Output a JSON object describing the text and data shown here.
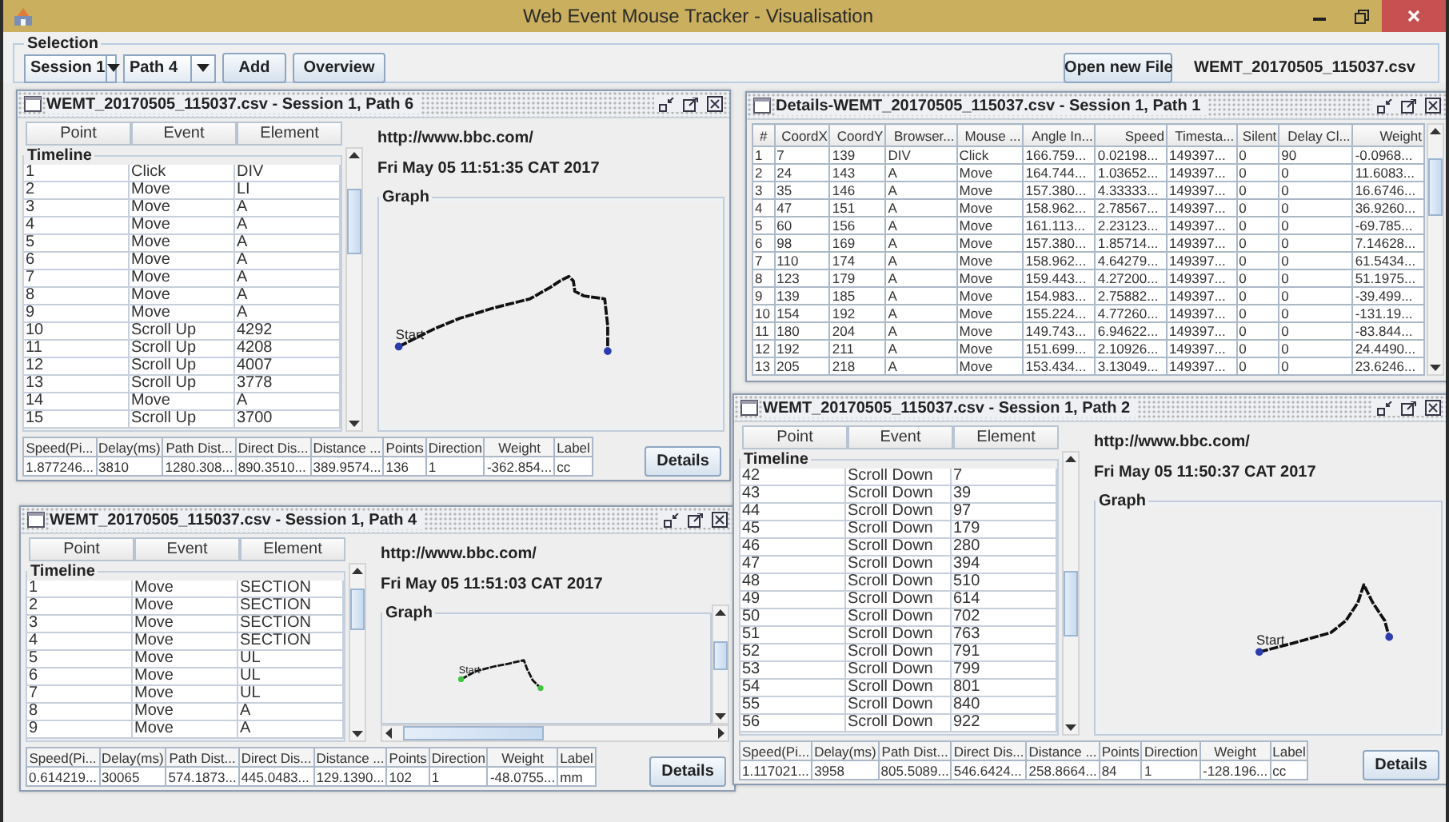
{
  "window": {
    "title": "Web Event Mouse Tracker - Visualisation"
  },
  "selection": {
    "legend": "Selection",
    "session": "Session 1",
    "path": "Path 4",
    "add_button": "Add",
    "overview_button": "Overview",
    "open_button": "Open new File",
    "file_name": "WEMT_20170505_115037.csv"
  },
  "frames": [
    {
      "kind": "path",
      "title": "WEMT_20170505_115037.csv - Session 1, Path 6",
      "columns": [
        "Point",
        "Event",
        "Element"
      ],
      "timeline_label": "Timeline",
      "rows": [
        [
          "1",
          "Click",
          "DIV"
        ],
        [
          "2",
          "Move",
          "LI"
        ],
        [
          "3",
          "Move",
          "A"
        ],
        [
          "4",
          "Move",
          "A"
        ],
        [
          "5",
          "Move",
          "A"
        ],
        [
          "6",
          "Move",
          "A"
        ],
        [
          "7",
          "Move",
          "A"
        ],
        [
          "8",
          "Move",
          "A"
        ],
        [
          "9",
          "Move",
          "A"
        ],
        [
          "10",
          "Scroll Up",
          "4292"
        ],
        [
          "11",
          "Scroll Up",
          "4208"
        ],
        [
          "12",
          "Scroll Up",
          "4007"
        ],
        [
          "13",
          "Scroll Up",
          "3778"
        ],
        [
          "14",
          "Move",
          "A"
        ],
        [
          "15",
          "Scroll Up",
          "3700"
        ]
      ],
      "url": "http://www.bbc.com/",
      "date": "Fri May 05 11:51:35 CAT 2017",
      "graph": {
        "title": "Graph",
        "start_label": "Start",
        "color": "#2a3cb0"
      },
      "stats_columns": [
        "Speed(Pi...",
        "Delay(ms)",
        "Path Dist...",
        "Direct Dis...",
        "Distance ...",
        "Points",
        "Direction",
        "Weight",
        "Label"
      ],
      "stats_values": [
        "1.877246...",
        "3810",
        "1280.308...",
        "890.3510...",
        "389.9574...",
        "136",
        "1",
        "-362.854...",
        "cc"
      ],
      "details_button": "Details"
    },
    {
      "kind": "path",
      "title": "WEMT_20170505_115037.csv - Session 1, Path 4",
      "columns": [
        "Point",
        "Event",
        "Element"
      ],
      "timeline_label": "Timeline",
      "rows": [
        [
          "1",
          "Move",
          "SECTION"
        ],
        [
          "2",
          "Move",
          "SECTION"
        ],
        [
          "3",
          "Move",
          "SECTION"
        ],
        [
          "4",
          "Move",
          "SECTION"
        ],
        [
          "5",
          "Move",
          "UL"
        ],
        [
          "6",
          "Move",
          "UL"
        ],
        [
          "7",
          "Move",
          "UL"
        ],
        [
          "8",
          "Move",
          "A"
        ],
        [
          "9",
          "Move",
          "A"
        ]
      ],
      "url": "http://www.bbc.com/",
      "date": "Fri May 05 11:51:03 CAT 2017",
      "graph": {
        "title": "Graph",
        "start_label": "Start",
        "color": "#3cc83c",
        "scrollbars": true
      },
      "stats_columns": [
        "Speed(Pi...",
        "Delay(ms)",
        "Path Dist...",
        "Direct Dis...",
        "Distance ...",
        "Points",
        "Direction",
        "Weight",
        "Label"
      ],
      "stats_values": [
        "0.614219...",
        "30065",
        "574.1873...",
        "445.0483...",
        "129.1390...",
        "102",
        "1",
        "-48.0755...",
        "mm"
      ],
      "details_button": "Details"
    },
    {
      "kind": "details",
      "title": "Details-WEMT_20170505_115037.csv - Session 1, Path 1",
      "columns": [
        "#",
        "CoordX",
        "CoordY",
        "Browser...",
        "Mouse ...",
        "Angle In...",
        "Speed",
        "Timesta...",
        "Silent",
        "Delay Cl...",
        "Weight"
      ],
      "rows": [
        [
          "1",
          "7",
          "139",
          "DIV",
          "Click",
          "166.759...",
          "0.02198...",
          "149397...",
          "0",
          "90",
          "-0.0968..."
        ],
        [
          "2",
          "24",
          "143",
          "A",
          "Move",
          "164.744...",
          "1.03652...",
          "149397...",
          "0",
          "0",
          "11.6083..."
        ],
        [
          "3",
          "35",
          "146",
          "A",
          "Move",
          "157.380...",
          "4.33333...",
          "149397...",
          "0",
          "0",
          "16.6746..."
        ],
        [
          "4",
          "47",
          "151",
          "A",
          "Move",
          "158.962...",
          "2.78567...",
          "149397...",
          "0",
          "0",
          "36.9260..."
        ],
        [
          "5",
          "60",
          "156",
          "A",
          "Move",
          "161.113...",
          "2.23123...",
          "149397...",
          "0",
          "0",
          "-69.785..."
        ],
        [
          "6",
          "98",
          "169",
          "A",
          "Move",
          "157.380...",
          "1.85714...",
          "149397...",
          "0",
          "0",
          "7.14628..."
        ],
        [
          "7",
          "110",
          "174",
          "A",
          "Move",
          "158.962...",
          "4.64279...",
          "149397...",
          "0",
          "0",
          "61.5434..."
        ],
        [
          "8",
          "123",
          "179",
          "A",
          "Move",
          "159.443...",
          "4.27200...",
          "149397...",
          "0",
          "0",
          "51.1975..."
        ],
        [
          "9",
          "139",
          "185",
          "A",
          "Move",
          "154.983...",
          "2.75882...",
          "149397...",
          "0",
          "0",
          "-39.499..."
        ],
        [
          "10",
          "154",
          "192",
          "A",
          "Move",
          "155.224...",
          "4.77260...",
          "149397...",
          "0",
          "0",
          "-131.19..."
        ],
        [
          "11",
          "180",
          "204",
          "A",
          "Move",
          "149.743...",
          "6.94622...",
          "149397...",
          "0",
          "0",
          "-83.844..."
        ],
        [
          "12",
          "192",
          "211",
          "A",
          "Move",
          "151.699...",
          "2.10926...",
          "149397...",
          "0",
          "0",
          "24.4490..."
        ],
        [
          "13",
          "205",
          "218",
          "A",
          "Move",
          "153.434...",
          "3.13049...",
          "149397...",
          "0",
          "0",
          "23.6246..."
        ]
      ]
    },
    {
      "kind": "path",
      "title": "WEMT_20170505_115037.csv - Session 1, Path 2",
      "columns": [
        "Point",
        "Event",
        "Element"
      ],
      "timeline_label": "Timeline",
      "rows": [
        [
          "42",
          "Scroll Down",
          "7"
        ],
        [
          "43",
          "Scroll Down",
          "39"
        ],
        [
          "44",
          "Scroll Down",
          "97"
        ],
        [
          "45",
          "Scroll Down",
          "179"
        ],
        [
          "46",
          "Scroll Down",
          "280"
        ],
        [
          "47",
          "Scroll Down",
          "394"
        ],
        [
          "48",
          "Scroll Down",
          "510"
        ],
        [
          "49",
          "Scroll Down",
          "614"
        ],
        [
          "50",
          "Scroll Down",
          "702"
        ],
        [
          "51",
          "Scroll Down",
          "763"
        ],
        [
          "52",
          "Scroll Down",
          "791"
        ],
        [
          "53",
          "Scroll Down",
          "799"
        ],
        [
          "54",
          "Scroll Down",
          "801"
        ],
        [
          "55",
          "Scroll Down",
          "840"
        ],
        [
          "56",
          "Scroll Down",
          "922"
        ]
      ],
      "url": "http://www.bbc.com/",
      "date": "Fri May 05 11:50:37 CAT 2017",
      "graph": {
        "title": "Graph",
        "start_label": "Start",
        "color": "#2a3cb0"
      },
      "stats_columns": [
        "Speed(Pi...",
        "Delay(ms)",
        "Path Dist...",
        "Direct Dis...",
        "Distance ...",
        "Points",
        "Direction",
        "Weight",
        "Label"
      ],
      "stats_values": [
        "1.117021...",
        "3958",
        "805.5089...",
        "546.6424...",
        "258.8664...",
        "84",
        "1",
        "-128.196...",
        "cc"
      ],
      "details_button": "Details"
    }
  ]
}
